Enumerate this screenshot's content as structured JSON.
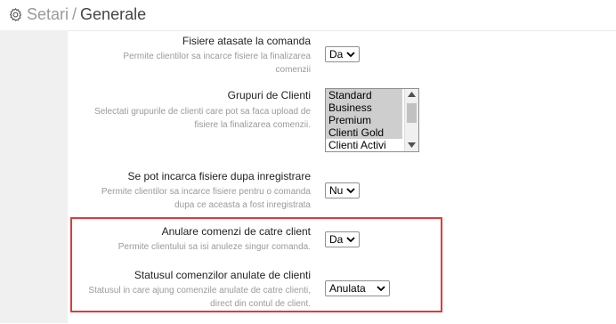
{
  "header": {
    "section": "Setari",
    "separator": "/",
    "title": "Generale",
    "icon": "gear-icon"
  },
  "settings": [
    {
      "label": "Fisiere atasate la comanda",
      "help_lines": [
        "Permite clientilor sa incarce fisiere la finalizarea",
        "comenzii"
      ],
      "value": "Da"
    },
    {
      "label": "Grupuri de Clienti",
      "help_lines": [
        "Selectati grupurile de clienti care pot sa faca upload de",
        "fisiere la finalizarea comenzii."
      ],
      "options": [
        {
          "label": "Standard",
          "selected": true
        },
        {
          "label": "Business",
          "selected": true
        },
        {
          "label": "Premium",
          "selected": true
        },
        {
          "label": "Clienti Gold",
          "selected": true
        },
        {
          "label": "Clienti Activi",
          "selected": false
        }
      ]
    },
    {
      "label": "Se pot incarca fisiere dupa inregistrare",
      "help_lines": [
        "Permite clientilor sa incarce fisiere pentru o comanda",
        "dupa ce aceasta a fost inregistrata"
      ],
      "value": "Nu"
    },
    {
      "label": "Anulare comenzi de catre client",
      "help_lines": [
        "Permite clientului sa isi anuleze singur comanda."
      ],
      "value": "Da"
    },
    {
      "label": "Statusul comenzilor anulate de clienti",
      "help_lines": [
        "Statusul in care ajung comenzile anulate de catre clienti,",
        "direct din contul de client."
      ],
      "value": "Anulata"
    }
  ],
  "colors": {
    "highlight_border": "#e0393e",
    "sidebar_bg": "#f0f0f0",
    "help_text": "#9a9a9a",
    "selected_option_bg": "#cecece"
  }
}
